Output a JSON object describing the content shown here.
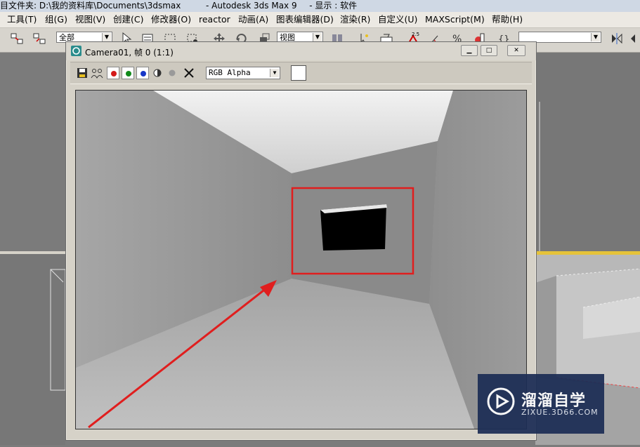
{
  "window": {
    "title_path": "目文件夹: D:\\我的资料库\\Documents\\3dsmax",
    "title_app": "- Autodesk 3ds Max 9",
    "title_display": "- 显示 : 软件"
  },
  "menu": {
    "items": [
      "工具(T)",
      "组(G)",
      "视图(V)",
      "创建(C)",
      "修改器(O)",
      "reactor",
      "动画(A)",
      "图表编辑器(D)",
      "渲染(R)",
      "自定义(U)",
      "MAXScript(M)",
      "帮助(H)"
    ]
  },
  "toolbar": {
    "selection_filter": "全部",
    "reference_coord": "视图",
    "snap_angle_label": "2.5",
    "named_selection": ""
  },
  "frame_window": {
    "title": "Camera01, 帧 0 (1:1)",
    "channel_select": "RGB Alpha",
    "buttons": [
      "save-image",
      "clone-window",
      "red-channel",
      "green-channel",
      "blue-channel",
      "mono-display",
      "alpha-channel",
      "clear"
    ]
  },
  "watermark": {
    "brand": "溜溜自学",
    "url": "ZIXUE.3D66.COM"
  },
  "colors": {
    "highlight_box": "#e01e1e",
    "arrow": "#e01e1e",
    "red_channel": "#d41a1a",
    "green_channel": "#118a1a",
    "blue_channel": "#1737c8"
  }
}
